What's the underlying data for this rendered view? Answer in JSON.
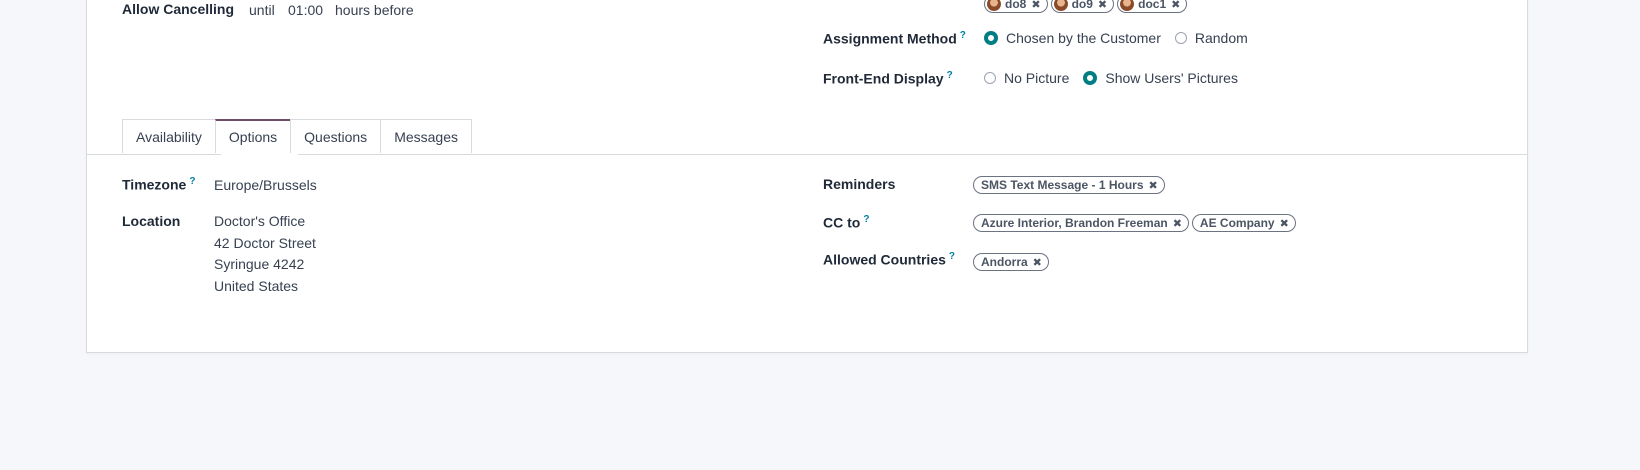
{
  "top": {
    "allow_cancelling_label": "Allow Cancelling",
    "until_text": "until",
    "cancel_time": "01:00",
    "hours_before_text": "hours before",
    "staff_tags": [
      {
        "label": "do8"
      },
      {
        "label": "do9"
      },
      {
        "label": "doc1"
      }
    ],
    "assignment_method_label": "Assignment Method",
    "assignment_options": [
      "Chosen by the Customer",
      "Random"
    ],
    "assignment_selected": "Chosen by the Customer",
    "front_end_display_label": "Front-End Display",
    "display_options": [
      "No Picture",
      "Show Users' Pictures"
    ],
    "display_selected": "Show Users' Pictures"
  },
  "tabs": [
    "Availability",
    "Options",
    "Questions",
    "Messages"
  ],
  "active_tab": "Options",
  "options": {
    "timezone_label": "Timezone",
    "timezone_value": "Europe/Brussels",
    "location_label": "Location",
    "location_lines": [
      "Doctor's Office",
      "42 Doctor Street",
      "Syringue 4242",
      "United States"
    ],
    "reminders_label": "Reminders",
    "reminders": [
      "SMS Text Message - 1 Hours"
    ],
    "cc_label": "CC to",
    "cc": [
      "Azure Interior, Brandon Freeman",
      "AE Company"
    ],
    "allowed_countries_label": "Allowed Countries",
    "allowed_countries": [
      "Andorra"
    ]
  },
  "help_mark": "?",
  "remove_glyph": "✖",
  "colors": {
    "accent": "#017e84",
    "tab_active": "#714b67",
    "help": "#0180a5"
  }
}
